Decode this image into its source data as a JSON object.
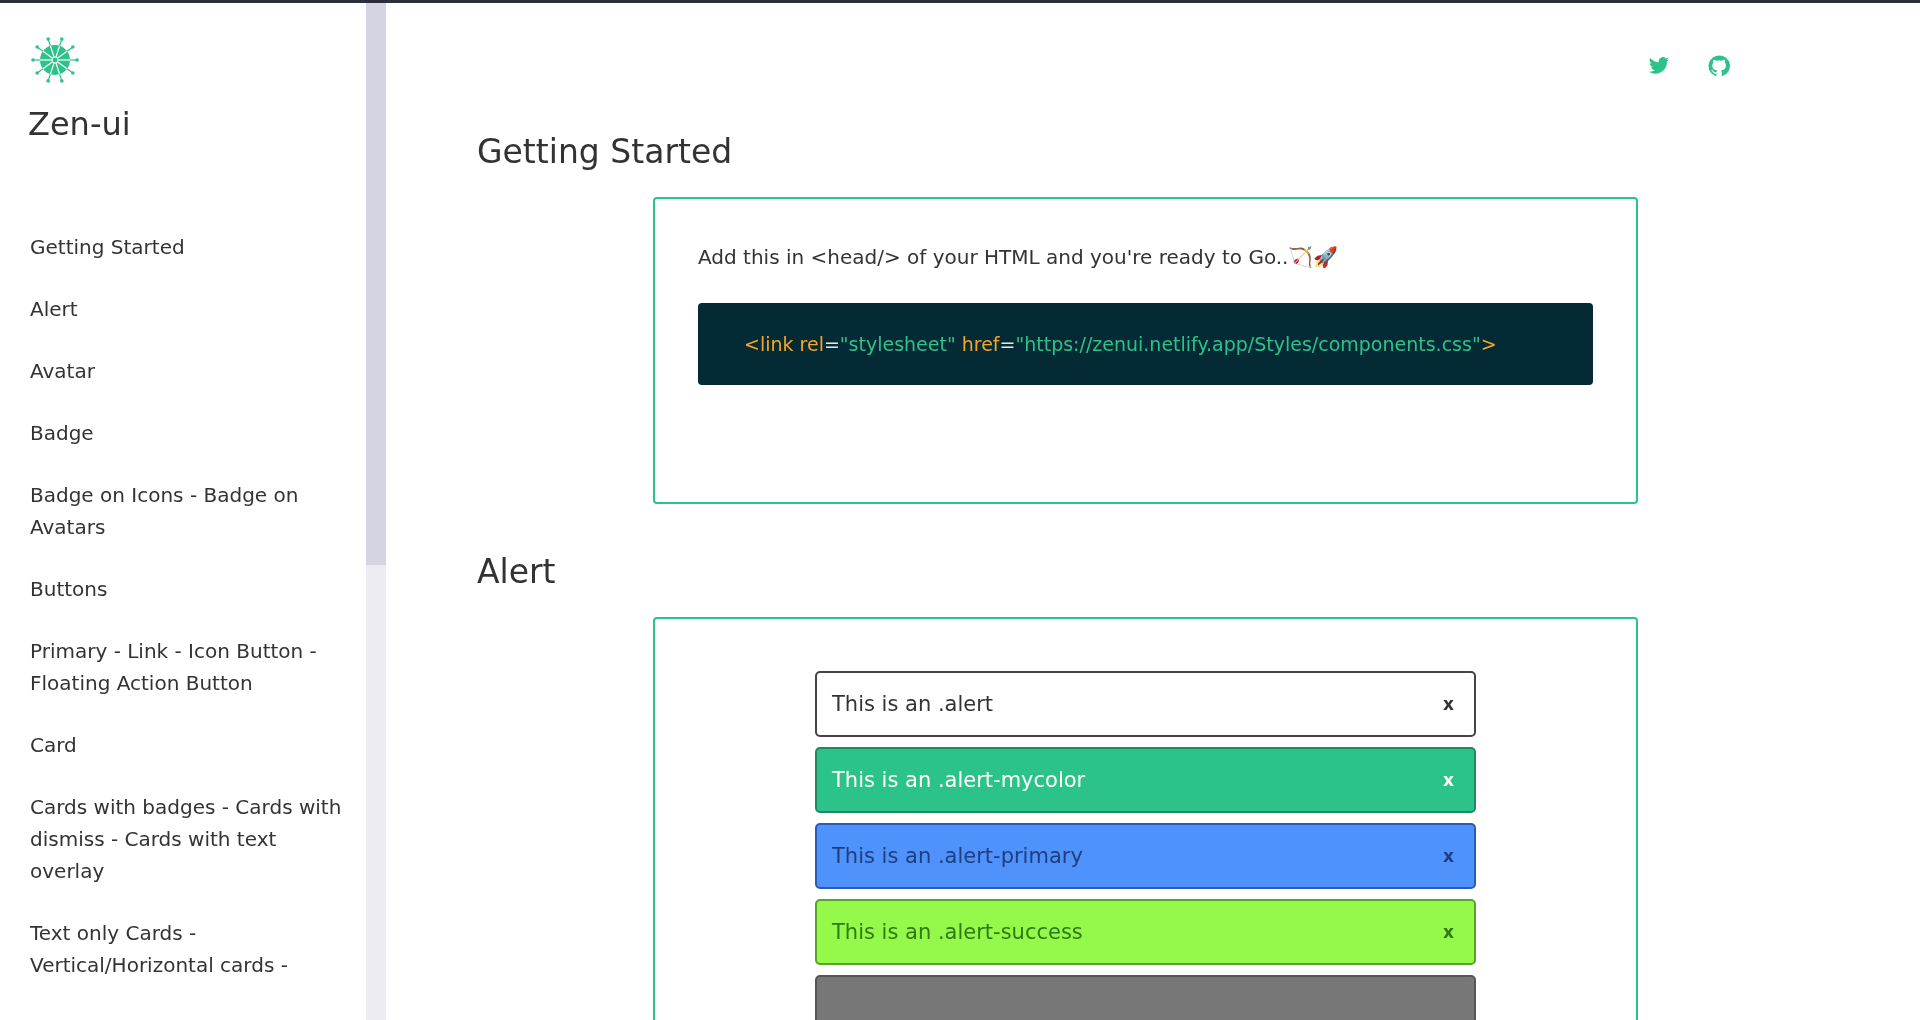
{
  "sidebar": {
    "brand": "Zen-ui",
    "items": [
      {
        "label": "Getting Started"
      },
      {
        "label": "Alert"
      },
      {
        "label": "Avatar"
      },
      {
        "label": "Badge"
      },
      {
        "label": "Badge on Icons - Badge on Avatars"
      },
      {
        "label": "Buttons"
      },
      {
        "label": "Primary - Link - Icon Button - Floating Action Button"
      },
      {
        "label": "Card"
      },
      {
        "label": "Cards with badges - Cards with dismiss - Cards with text overlay"
      },
      {
        "label": "Text only Cards - Vertical/Horizontal cards -"
      }
    ]
  },
  "sections": [
    {
      "title": "Getting Started",
      "kind": "setup",
      "intro": "Add this in <head/> of your HTML and you're ready to Go..🏹🚀",
      "code": [
        {
          "text": "<",
          "kind": "tag"
        },
        {
          "text": "link rel",
          "kind": "tag"
        },
        {
          "text": "=",
          "kind": "punct"
        },
        {
          "text": "\"stylesheet\"",
          "kind": "string"
        },
        {
          "text": " href",
          "kind": "tag"
        },
        {
          "text": "=",
          "kind": "punct"
        },
        {
          "text": "\"https://zenui.netlify.app/Styles/components.css\"",
          "kind": "string"
        },
        {
          "text": ">",
          "kind": "tag"
        }
      ]
    },
    {
      "title": "Alert",
      "kind": "alerts",
      "alerts": [
        {
          "kind": "default",
          "text": "This is an .alert",
          "close": "x"
        },
        {
          "kind": "mycolor",
          "text": "This is an .alert-mycolor",
          "close": "x"
        },
        {
          "kind": "primary",
          "text": "This is an .alert-primary",
          "close": "x"
        },
        {
          "kind": "success",
          "text": "This is an .alert-success",
          "close": "x"
        },
        {
          "kind": "dark"
        }
      ]
    }
  ]
}
